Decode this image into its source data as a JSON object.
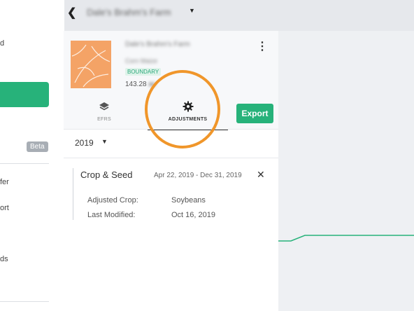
{
  "sidebar": {
    "item_1": "d",
    "item_2": "fer",
    "item_3": "ort",
    "item_4": "ds",
    "beta_badge": "Beta"
  },
  "header": {
    "farm_name": "Dale's Brahm's Farm"
  },
  "field": {
    "name": "Dale's Brahm's Farm",
    "subtitle": "Corn Maize",
    "tag": "BOUNDARY",
    "acres_value": "143.28",
    "acres_unit": "ac"
  },
  "tabs": {
    "efrs": "EFRS",
    "adjustments": "ADJUSTMENTS"
  },
  "actions": {
    "export": "Export"
  },
  "year_select": {
    "value": "2019"
  },
  "adjustment_card": {
    "title": "Crop & Seed",
    "date_range": "Apr 22, 2019 - Dec 31, 2019",
    "close_glyph": "✕",
    "crop_label": "Adjusted Crop:",
    "crop_value": "Soybeans",
    "modified_label": "Last Modified:",
    "modified_value": "Oct 16, 2019"
  },
  "colors": {
    "accent_green": "#27b27a",
    "highlight_orange": "#f0962a",
    "thumbnail_orange": "#f4a366"
  },
  "icons": {
    "back": "chevron-left-icon",
    "farm_dropdown": "caret-down-icon",
    "menu": "kebab-menu-icon",
    "efrs": "layers-icon",
    "adjustments": "gear-icon",
    "year_dropdown": "caret-down-icon",
    "close": "close-icon"
  }
}
